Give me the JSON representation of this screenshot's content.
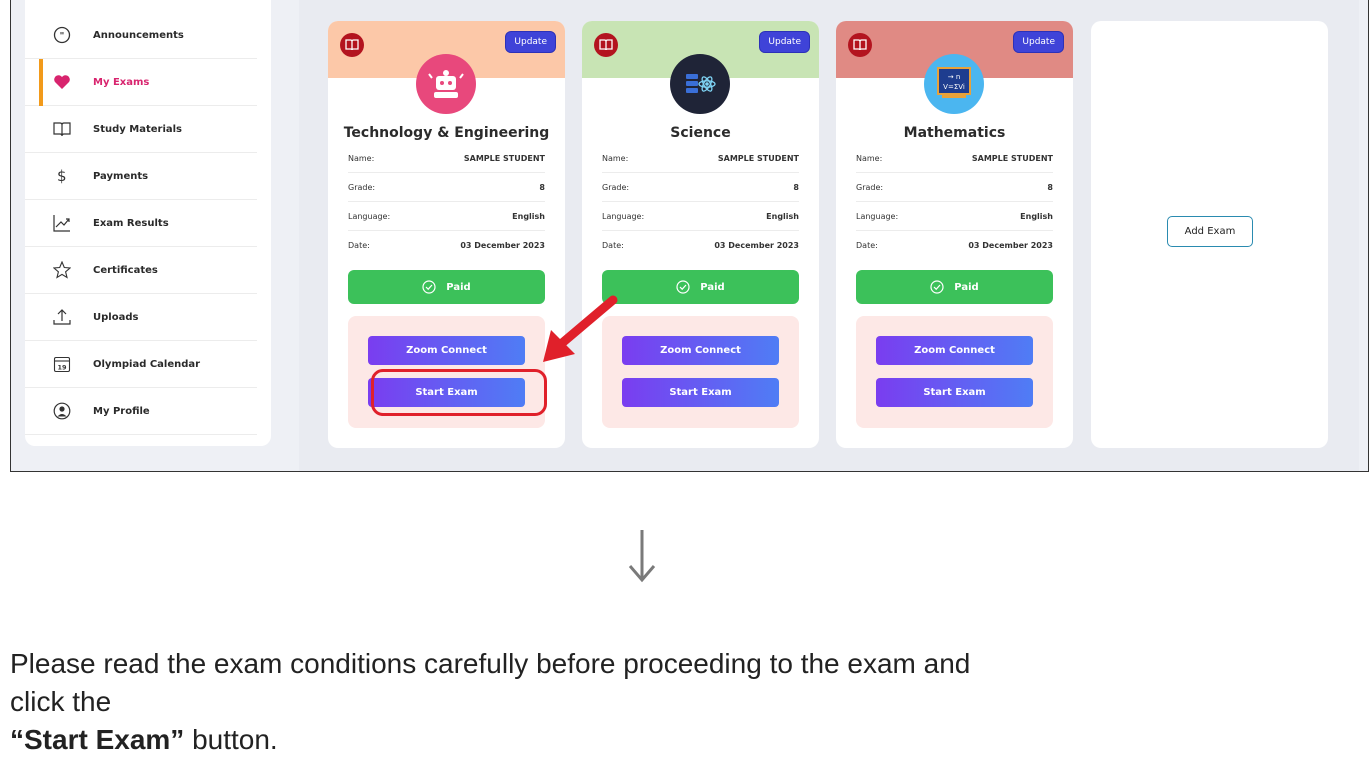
{
  "sidebar": {
    "items": [
      {
        "label": "Announcements",
        "icon": "speech-bubble-icon",
        "active": false
      },
      {
        "label": "My Exams",
        "icon": "heart-icon",
        "active": true
      },
      {
        "label": "Study Materials",
        "icon": "book-icon",
        "active": false
      },
      {
        "label": "Payments",
        "icon": "dollar-icon",
        "active": false
      },
      {
        "label": "Exam Results",
        "icon": "trend-chart-icon",
        "active": false
      },
      {
        "label": "Certificates",
        "icon": "star-icon",
        "active": false
      },
      {
        "label": "Uploads",
        "icon": "upload-icon",
        "active": false
      },
      {
        "label": "Olympiad Calendar",
        "icon": "calendar-icon",
        "active": false
      },
      {
        "label": "My Profile",
        "icon": "user-circle-icon",
        "active": false
      }
    ],
    "calendar_day": "19",
    "active_color": "#d8246e",
    "active_bar_color": "#f29a1a"
  },
  "exams": [
    {
      "title": "Technology & Engineering",
      "header_color": "#fcc8a8",
      "icon": "robot-icon",
      "update_label": "Update",
      "fields": [
        {
          "label": "Name:",
          "value": "SAMPLE STUDENT"
        },
        {
          "label": "Grade:",
          "value": "8"
        },
        {
          "label": "Language:",
          "value": "English"
        },
        {
          "label": "Date:",
          "value": "03 December 2023"
        }
      ],
      "paid_label": "Paid",
      "zoom_label": "Zoom Connect",
      "start_label": "Start Exam"
    },
    {
      "title": "Science",
      "header_color": "#c8e4b4",
      "icon": "atom-server-icon",
      "update_label": "Update",
      "fields": [
        {
          "label": "Name:",
          "value": "SAMPLE STUDENT"
        },
        {
          "label": "Grade:",
          "value": "8"
        },
        {
          "label": "Language:",
          "value": "English"
        },
        {
          "label": "Date:",
          "value": "03 December 2023"
        }
      ],
      "paid_label": "Paid",
      "zoom_label": "Zoom Connect",
      "start_label": "Start Exam"
    },
    {
      "title": "Mathematics",
      "header_color": "#e08a84",
      "icon": "chalkboard-formula-icon",
      "update_label": "Update",
      "fields": [
        {
          "label": "Name:",
          "value": "SAMPLE STUDENT"
        },
        {
          "label": "Grade:",
          "value": "8"
        },
        {
          "label": "Language:",
          "value": "English"
        },
        {
          "label": "Date:",
          "value": "03 December 2023"
        }
      ],
      "paid_label": "Paid",
      "zoom_label": "Zoom Connect",
      "start_label": "Start Exam"
    }
  ],
  "add_exam_label": "Add Exam",
  "instruction": {
    "text_before": "Please read the exam conditions carefully before proceeding to the exam and click the",
    "bold": "“Start Exam”",
    "text_after": " button."
  },
  "colors": {
    "paid": "#3cc15a",
    "update": "#3f43d8",
    "highlight": "#e0202a"
  }
}
